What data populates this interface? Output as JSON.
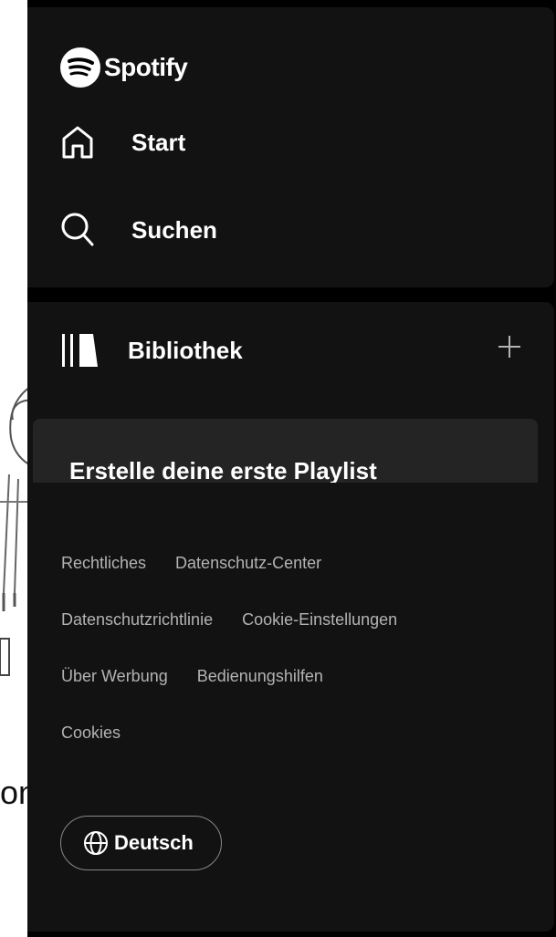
{
  "background": {
    "partial_text": "on"
  },
  "nav": {
    "logo_text": "Spotify",
    "items": [
      {
        "label": "Start",
        "icon": "home-icon"
      },
      {
        "label": "Suchen",
        "icon": "search-icon"
      }
    ]
  },
  "library": {
    "title": "Bibliothek",
    "add_icon": "plus-icon",
    "card_title": "Erstelle deine erste Playlist"
  },
  "footer": {
    "links": [
      [
        "Rechtliches",
        "Datenschutz-Center"
      ],
      [
        "Datenschutzrichtlinie",
        "Cookie-Einstellungen"
      ],
      [
        "Über Werbung",
        "Bedienungshilfen"
      ],
      [
        "Cookies"
      ]
    ],
    "language_label": "Deutsch"
  },
  "colors": {
    "sidebar_bg": "#000000",
    "panel_bg": "#121212",
    "card_bg": "#242424",
    "text_primary": "#ffffff",
    "text_secondary": "#b3b3b3"
  }
}
